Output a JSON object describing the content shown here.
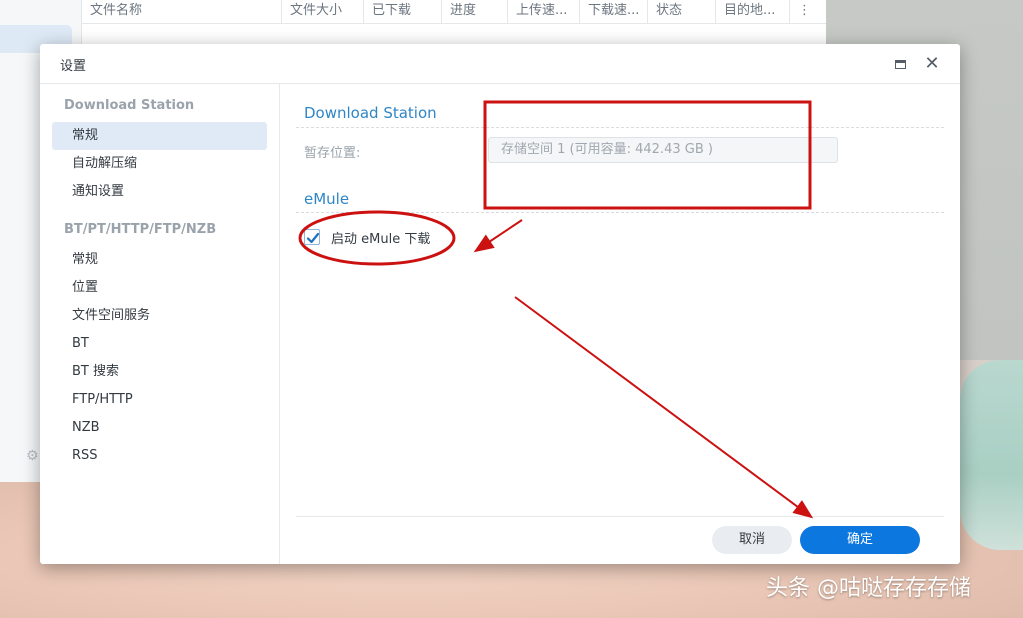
{
  "background_window": {
    "columns": [
      "文件名称",
      "文件大小",
      "已下载",
      "进度",
      "上传速...",
      "下载速...",
      "状态",
      "目的地...",
      "⋮"
    ]
  },
  "dialog": {
    "title": "设置",
    "sidebar": {
      "group1_title": "Download Station",
      "group1_items": [
        "常规",
        "自动解压缩",
        "通知设置"
      ],
      "group2_title": "BT/PT/HTTP/FTP/NZB",
      "group2_items": [
        "常规",
        "位置",
        "文件空间服务",
        "BT",
        "BT 搜索",
        "FTP/HTTP",
        "NZB",
        "RSS"
      ]
    },
    "main": {
      "section1_title": "Download Station",
      "temp_location_label": "暂存位置:",
      "temp_location_value": "存储空间 1 (可用容量:  442.43 GB )",
      "section2_title": "eMule",
      "emule_checkbox_label": "启动 eMule 下载",
      "emule_checkbox_checked": true
    },
    "buttons": {
      "cancel": "取消",
      "ok": "确定"
    }
  },
  "watermark": "头条 @咕哒存存存储",
  "colors": {
    "accent": "#2f86c6",
    "primary_button": "#0d77e0",
    "annotation_red": "#cc1111"
  }
}
